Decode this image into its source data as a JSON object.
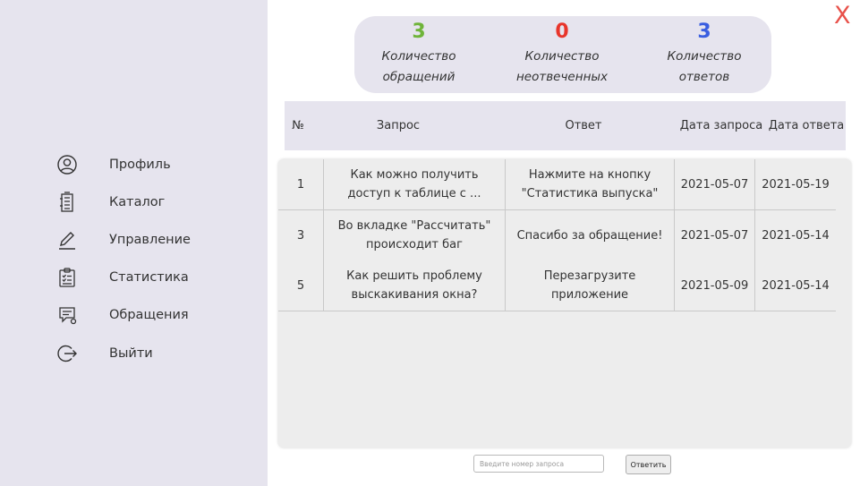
{
  "sidebar": {
    "items": [
      {
        "label": "Профиль",
        "icon": "user-icon"
      },
      {
        "label": "Каталог",
        "icon": "catalog-icon"
      },
      {
        "label": "Управление",
        "icon": "pencil-icon"
      },
      {
        "label": "Статистика",
        "icon": "clipboard-icon"
      },
      {
        "label": "Обращения",
        "icon": "support-chat-icon"
      },
      {
        "label": "Выйти",
        "icon": "logout-icon"
      }
    ]
  },
  "window": {
    "close_label": "X"
  },
  "stats": {
    "requests": {
      "value": "3",
      "label": "Количество обращений",
      "color": "#6fb43a"
    },
    "unanswered": {
      "value": "0",
      "label": "Количество неотвеченных",
      "color": "#e8352b"
    },
    "answers": {
      "value": "3",
      "label": "Количество ответов",
      "color": "#3a5ee0"
    }
  },
  "table": {
    "columns": [
      "№",
      "Запрос",
      "Ответ",
      "Дата запроса",
      "Дата ответа"
    ],
    "rows": [
      {
        "num": "1",
        "request": "Как можно получить доступ к таблице с ...",
        "answer": "Нажмите на кнопку \"Статистика выпуска\"",
        "request_date": "2021-05-07",
        "answer_date": "2021-05-19"
      },
      {
        "num": "3",
        "request": "Во вкладке \"Рассчитать\" происходит баг",
        "answer": "Спасибо за обращение!",
        "request_date": "2021-05-07",
        "answer_date": "2021-05-14"
      },
      {
        "num": "5",
        "request": "Как решить проблему выскакивания окна?",
        "answer": "Перезагрузите приложение",
        "request_date": "2021-05-09",
        "answer_date": "2021-05-14"
      }
    ]
  },
  "reply": {
    "placeholder": "Введите номер запроса",
    "value": "",
    "button_label": "Ответить"
  }
}
